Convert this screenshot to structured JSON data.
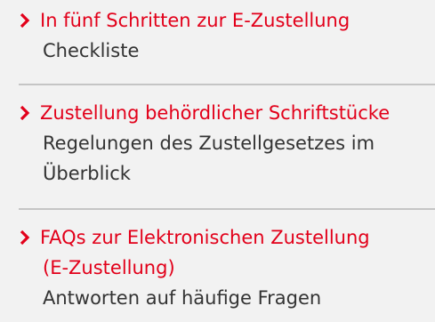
{
  "links": [
    {
      "title": "In fünf Schritten zur E-Zustellung",
      "description": [
        "Checkliste"
      ]
    },
    {
      "title": "Zustellung behördlicher Schriftstücke",
      "description": [
        "Regelungen des Zustellgesetzes im",
        "Überblick"
      ]
    },
    {
      "title": "FAQs zur Elektronischen Zustellung",
      "title_line2": "(E-Zustellung)",
      "description": [
        "Antworten auf häufige Fragen"
      ]
    }
  ],
  "icon": "chevron-right-icon",
  "colors": {
    "accent": "#e2001a",
    "text": "#333333",
    "background": "#f2f2f2",
    "divider": "#c5c5c5"
  }
}
